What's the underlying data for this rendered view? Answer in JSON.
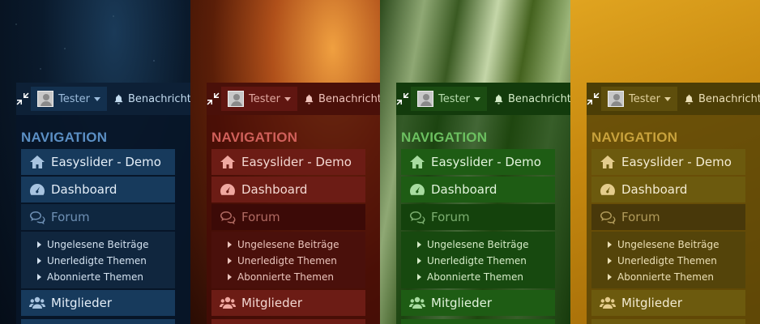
{
  "topbar": {
    "user_name": "Tester",
    "notifications_label": "Benachrichtigungen"
  },
  "sidebar": {
    "heading": "NAVIGATION",
    "items": [
      {
        "label": "Easyslider - Demo",
        "icon": "home-icon"
      },
      {
        "label": "Dashboard",
        "icon": "dashboard-gauge-icon"
      },
      {
        "label": "Forum",
        "icon": "comments-icon",
        "active": true,
        "children": [
          "Ungelesene Beiträge",
          "Unerledigte Themen",
          "Abonnierte Themen"
        ]
      },
      {
        "label": "Mitglieder",
        "icon": "users-icon"
      }
    ]
  },
  "themes": [
    {
      "name": "blue-space",
      "accent": "#5b8fc4"
    },
    {
      "name": "red-fire",
      "accent": "#d0605a"
    },
    {
      "name": "green-forest",
      "accent": "#6cc060"
    },
    {
      "name": "gold",
      "accent": "#c8a23c"
    }
  ]
}
